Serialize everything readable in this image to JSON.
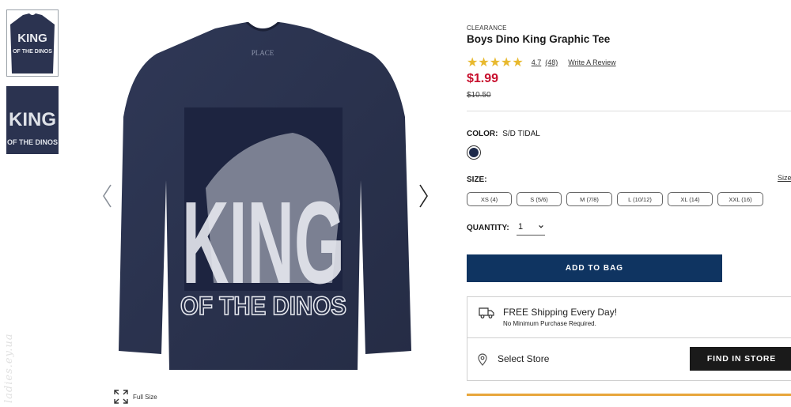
{
  "gallery": {
    "thumbnails": [
      {
        "alt": "front view",
        "print_text": "KING OF THE DINOS"
      },
      {
        "alt": "print detail",
        "print_text": "KING OF THE DINOS"
      }
    ],
    "main_print": {
      "line1": "KING",
      "line2": "OF THE DINOS",
      "collar_tag": "PLACE"
    },
    "prev_icon": "chevron-left-icon",
    "next_icon": "chevron-right-icon",
    "full_size_label": "Full Size",
    "watermark": "ladies.ey.ua"
  },
  "product": {
    "badge": "CLEARANCE",
    "title": "Boys Dino King Graphic Tee",
    "rating": "4.7",
    "rating_fraction": 0.94,
    "reviews": "(48)",
    "write_review": "Write A Review",
    "price": "$1.99",
    "old_price": "$10.50",
    "color_label": "COLOR:",
    "color_value": "S/D TIDAL",
    "swatch_color": "#1e2a4a",
    "size_label": "SIZE:",
    "size_guide": "Size",
    "sizes": [
      "XS (4)",
      "S (5/6)",
      "M (7/8)",
      "L (10/12)",
      "XL (14)",
      "XXL (16)"
    ],
    "quantity_label": "QUANTITY:",
    "quantity_value": "1",
    "add_to_bag": "ADD TO BAG"
  },
  "fulfillment": {
    "shipping_title": "FREE Shipping Every Day!",
    "shipping_sub": "No Minimum Purchase Required.",
    "select_store": "Select Store",
    "find_in_store": "FIND IN STORE"
  },
  "colors": {
    "brand_navy": "#0f3461",
    "price_red": "#c8102e",
    "star_gold": "#e8b92e",
    "shirt": "#2b3350",
    "promo_orange": "#e8a63c"
  }
}
